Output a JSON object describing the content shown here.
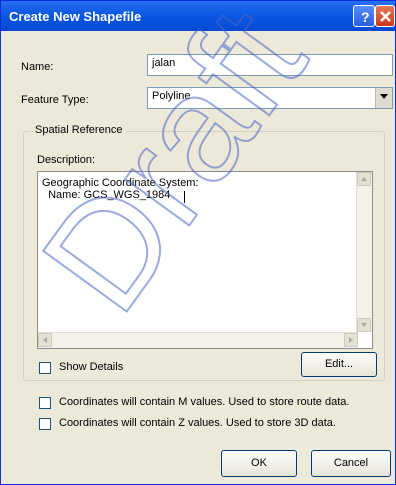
{
  "window": {
    "title": "Create New Shapefile",
    "help_icon": "question-mark-icon",
    "close_icon": "close-icon"
  },
  "form": {
    "name_label": "Name:",
    "name_value": "jalan",
    "feature_type_label": "Feature Type:",
    "feature_type_value": "Polyline"
  },
  "spatial_reference": {
    "group_title": "Spatial Reference",
    "description_label": "Description:",
    "description_line1": "Geographic Coordinate System:",
    "description_line2": "  Name: GCS_WGS_1984",
    "show_details_label": "Show Details",
    "show_details_checked": false,
    "edit_button": "Edit..."
  },
  "options": {
    "m_values_label": "Coordinates will contain M values. Used to store route data.",
    "m_values_checked": false,
    "z_values_label": "Coordinates will contain Z values. Used to store 3D data.",
    "z_values_checked": false
  },
  "buttons": {
    "ok": "OK",
    "cancel": "Cancel"
  },
  "watermark": {
    "text": "Draft",
    "color": "#4a63c8"
  },
  "colors": {
    "titlebar": "#0a58e4",
    "dialog_bg": "#ece9d8",
    "close_button": "#c8391a"
  }
}
